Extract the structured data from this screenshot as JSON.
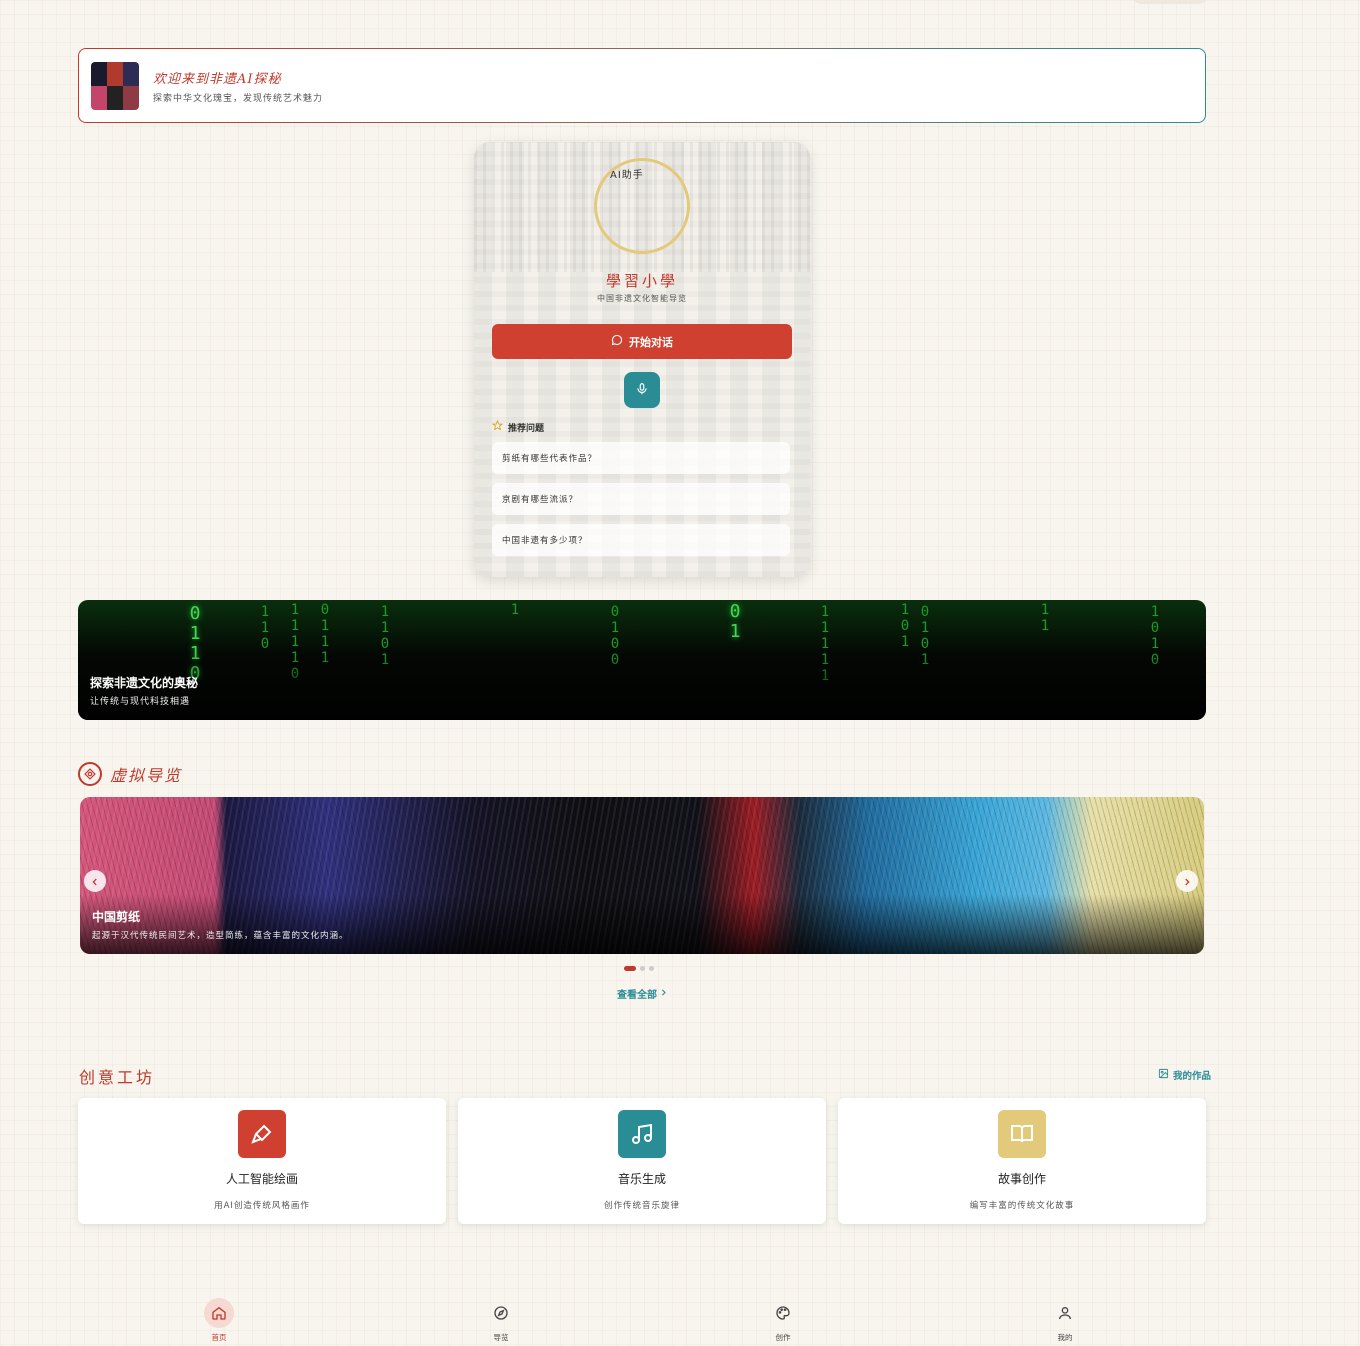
{
  "welcome": {
    "title": "欢迎来到非遗AI探秘",
    "subtitle": "探索中华文化瑰宝，发现传统艺术魅力"
  },
  "ai_card": {
    "avatar_label": "AI助手",
    "name": "學習小學",
    "subtitle": "中国非遗文化智能导览",
    "chat_button": "开始对话",
    "recommend_title": "推荐问题",
    "questions": [
      "剪纸有哪些代表作品？",
      "京剧有哪些流派？",
      "中国非遗有多少项？"
    ]
  },
  "matrix_banner": {
    "title": "探索非遗文化的奥秘",
    "subtitle": "让传统与现代科技相遇",
    "columns": [
      {
        "chars": "0\n1\n1\n0",
        "bright": true
      },
      {
        "chars": "1\n1\n1\n1\n0",
        "bright": false
      },
      {
        "chars": "1\n1\n0\n1",
        "bright": false
      },
      {
        "chars": "0\n1\n1\n1",
        "bright": false
      },
      {
        "chars": "1\n1\n0",
        "bright": false
      },
      {
        "chars": "1",
        "bright": false
      },
      {
        "chars": "0\n1\n0\n0",
        "bright": false
      },
      {
        "chars": "0\n1",
        "bright": true
      },
      {
        "chars": "1\n1\n1\n1\n1",
        "bright": false
      },
      {
        "chars": "1\n0\n1",
        "bright": false
      },
      {
        "chars": "0\n1\n0\n1",
        "bright": false
      },
      {
        "chars": "1\n1",
        "bright": false
      },
      {
        "chars": "1\n0\n1\n0",
        "bright": false
      }
    ]
  },
  "virtual_guide": {
    "title": "虚拟导览",
    "slide_title": "中国剪纸",
    "slide_desc": "起源于汉代传统民间艺术，造型简练，蕴含丰富的文化内涵。",
    "slides_count": 3,
    "active_slide": 0,
    "view_all": "查看全部"
  },
  "creative_workshop": {
    "title": "创意工坊",
    "my_works": "我的作品",
    "cards": [
      {
        "name": "人工智能绘画",
        "desc": "用AI创造传统风格画作",
        "color": "#cf4030",
        "icon": "brush-icon"
      },
      {
        "name": "音乐生成",
        "desc": "创作传统音乐旋律",
        "color": "#2a8c94",
        "icon": "music-note-icon"
      },
      {
        "name": "故事创作",
        "desc": "编写丰富的传统文化故事",
        "color": "#e3c97a",
        "icon": "book-icon"
      }
    ]
  },
  "bottom_nav": [
    {
      "label": "首页",
      "icon": "home-icon",
      "active": true
    },
    {
      "label": "导览",
      "icon": "compass-icon",
      "active": false
    },
    {
      "label": "创作",
      "icon": "palette-icon",
      "active": false
    },
    {
      "label": "我的",
      "icon": "user-icon",
      "active": false
    }
  ],
  "colors": {
    "primary_red": "#c0392b",
    "teal": "#2a8c94",
    "gold": "#e3c97a",
    "background": "#f8f5ef"
  }
}
